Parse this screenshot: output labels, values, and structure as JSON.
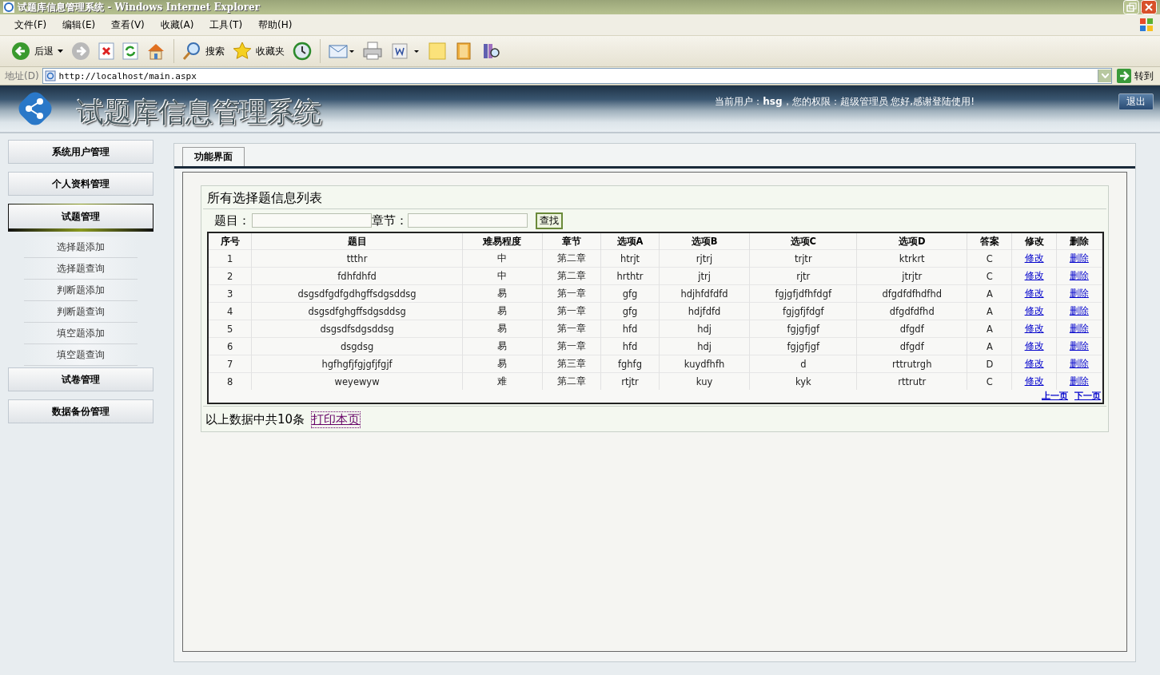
{
  "window": {
    "title": "试题库信息管理系统 - Windows Internet Explorer"
  },
  "menu": [
    "文件(F)",
    "编辑(E)",
    "查看(V)",
    "收藏(A)",
    "工具(T)",
    "帮助(H)"
  ],
  "toolbar": [
    {
      "kind": "back",
      "label": "后退"
    },
    {
      "kind": "forward"
    },
    {
      "kind": "stop"
    },
    {
      "kind": "refresh"
    },
    {
      "kind": "home"
    },
    {
      "kind": "search",
      "label": "搜索"
    },
    {
      "kind": "favorites",
      "label": "收藏夹"
    },
    {
      "kind": "history"
    },
    {
      "kind": "mail"
    },
    {
      "kind": "print"
    },
    {
      "kind": "word"
    },
    {
      "kind": "note"
    },
    {
      "kind": "book"
    },
    {
      "kind": "research"
    }
  ],
  "address": {
    "label": "地址(D)",
    "value": "http://localhost/main.aspx",
    "go": "转到"
  },
  "app": {
    "title": "试题库信息管理系统",
    "user_info": "当前用户：**hsg**，您的权限：超级管理员  您好,感谢登陆使用!",
    "logout": "退出"
  },
  "sidebar": [
    {
      "label": "系统用户管理",
      "expanded": false
    },
    {
      "label": "个人资料管理",
      "expanded": false
    },
    {
      "label": "试题管理",
      "expanded": true,
      "children": [
        "选择题添加",
        "选择题查询",
        "判断题添加",
        "判断题查询",
        "填空题添加",
        "填空题查询"
      ]
    },
    {
      "label": "试卷管理",
      "expanded": false
    },
    {
      "label": "数据备份管理",
      "expanded": false
    }
  ],
  "tabs": [
    {
      "label": "功能界面",
      "selected": true
    }
  ],
  "panel": {
    "title": "所有选择题信息列表",
    "filters": [
      "题目：",
      "章节："
    ],
    "search_button": "查找",
    "columns": [
      {
        "label": "序号",
        "kind": "text"
      },
      {
        "label": "题目",
        "kind": "text"
      },
      {
        "label": "难易程度",
        "kind": "text"
      },
      {
        "label": "章节",
        "kind": "text"
      },
      {
        "label": "选项A",
        "kind": "text"
      },
      {
        "label": "选项B",
        "kind": "text"
      },
      {
        "label": "选项C",
        "kind": "text"
      },
      {
        "label": "选项D",
        "kind": "text"
      },
      {
        "label": "答案",
        "kind": "text"
      },
      {
        "label": "修改",
        "kind": "link"
      },
      {
        "label": "删除",
        "kind": "link"
      }
    ],
    "rows": [
      [
        "1",
        "ttthr",
        "中",
        "第二章",
        "htrjt",
        "rjtrj",
        "trjtr",
        "ktrkrt",
        "C",
        "修改",
        "删除"
      ],
      [
        "2",
        "fdhfdhfd",
        "中",
        "第二章",
        "hrthtr",
        "jtrj",
        "rjtr",
        "jtrjtr",
        "C",
        "修改",
        "删除"
      ],
      [
        "3",
        "dsgsdfgdfgdhgffsdgsddsg",
        "易",
        "第一章",
        "gfg",
        "hdjhfdfdfd",
        "fgjgfjdfhfdgf",
        "dfgdfdfhdfhd",
        "A",
        "修改",
        "删除"
      ],
      [
        "4",
        "dsgsdfghgffsdgsddsg",
        "易",
        "第一章",
        "gfg",
        "hdjfdfd",
        "fgjgfjfdgf",
        "dfgdfdfhd",
        "A",
        "修改",
        "删除"
      ],
      [
        "5",
        "dsgsdfsdgsddsg",
        "易",
        "第一章",
        "hfd",
        "hdj",
        "fgjgfjgf",
        "dfgdf",
        "A",
        "修改",
        "删除"
      ],
      [
        "6",
        "dsgdsg",
        "易",
        "第一章",
        "hfd",
        "hdj",
        "fgjgfjgf",
        "dfgdf",
        "A",
        "修改",
        "删除"
      ],
      [
        "7",
        "hgfhgfjfgjgfjfgjf",
        "易",
        "第三章",
        "fghfg",
        "kuydfhfh",
        "d",
        "rttrutrgh",
        "D",
        "修改",
        "删除"
      ],
      [
        "8",
        "weyewyw",
        "难",
        "第二章",
        "rtjtr",
        "kuy",
        "kyk",
        "rttrutr",
        "C",
        "修改",
        "删除"
      ]
    ],
    "pager": [
      "上一页",
      "下一页"
    ],
    "summary": "以上数据中共10条",
    "print_link": "打印本页"
  }
}
